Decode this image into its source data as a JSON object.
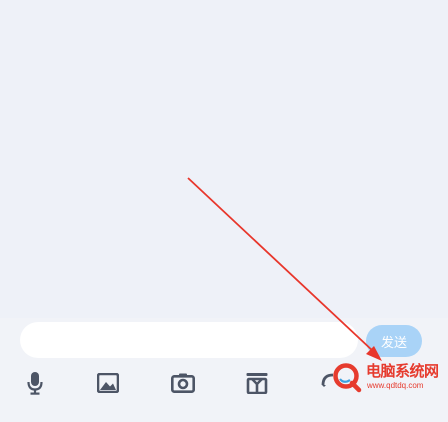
{
  "composer": {
    "input_value": "",
    "send_label": "发送"
  },
  "toolbar": {
    "icons": [
      "microphone-icon",
      "image-icon",
      "camera-icon",
      "gift-icon",
      "emoji-icon"
    ]
  },
  "watermark": {
    "name": "电脑系统网",
    "url": "www.qdtdq.com"
  },
  "colors": {
    "background": "#eef1f8",
    "send_button": "#a9d3f7",
    "icon": "#4d5566",
    "annotation_arrow": "#e8362b",
    "watermark": "#e63b2e"
  }
}
